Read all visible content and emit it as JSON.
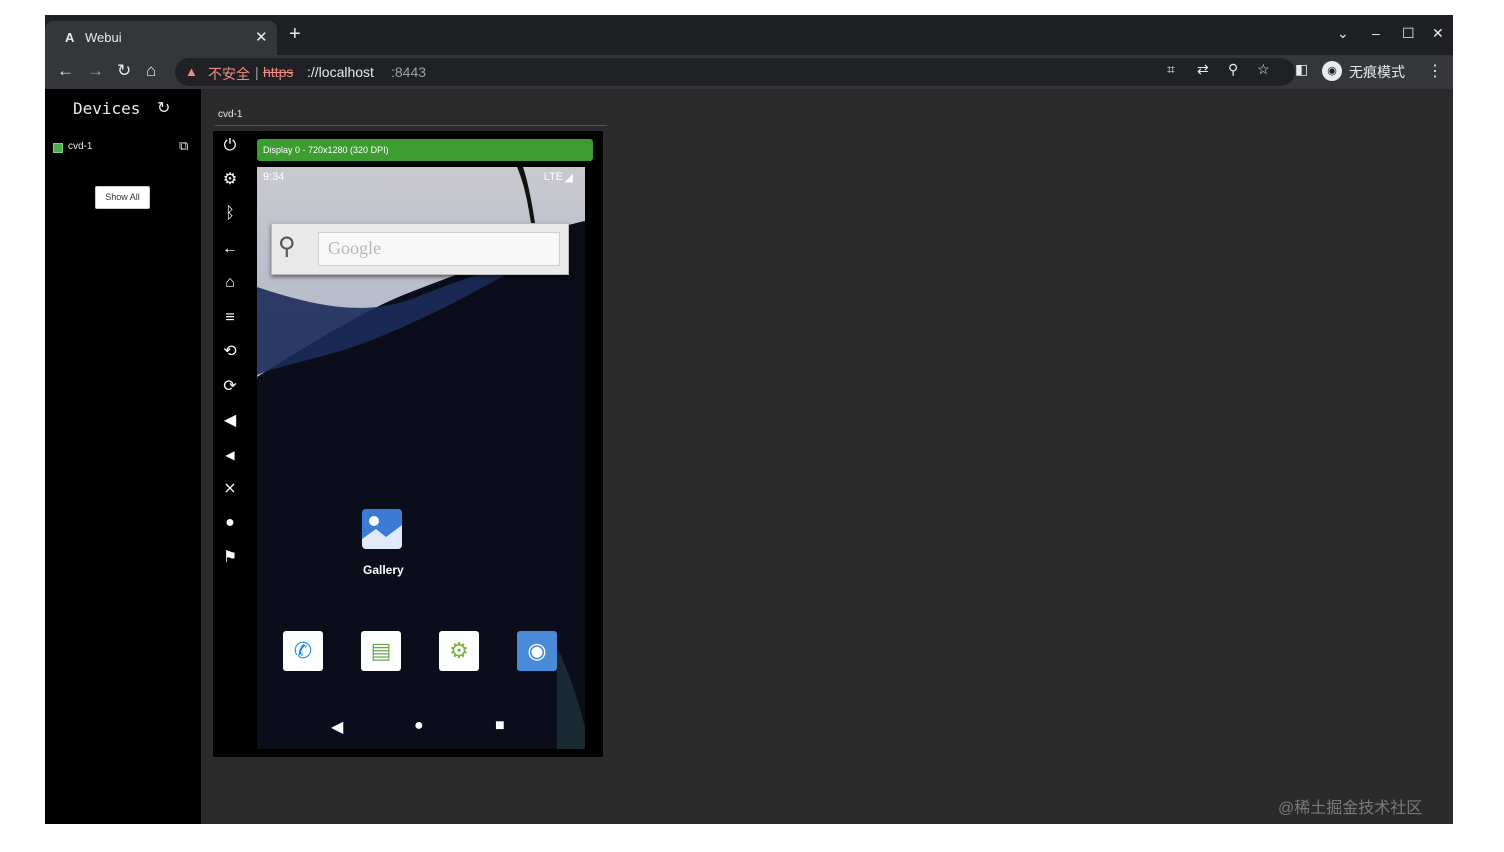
{
  "browser": {
    "tab_title": "Webui",
    "tab_favicon": "A",
    "warning_text": "不安全",
    "url_scheme": "https",
    "url_host": "://localhost",
    "url_port": ":8443",
    "profile_label": "无痕模式"
  },
  "sidebar": {
    "title": "Devices",
    "device_name": "cvd-1",
    "show_all": "Show All"
  },
  "device": {
    "tab_label": "cvd-1",
    "display_label": "Display 0 - 720x1280 (320 DPI)",
    "status_time": "9:34",
    "status_network": "LTE",
    "search_placeholder": "Google",
    "gallery_label": "Gallery"
  },
  "controls": [
    "power-icon",
    "settings-icon",
    "bluetooth-icon",
    "back-icon",
    "home-icon",
    "menu-icon",
    "rotate-left-icon",
    "rotate-right-icon",
    "volume-up-icon",
    "volume-down-icon",
    "volume-mute-icon",
    "microphone-icon",
    "location-icon"
  ],
  "watermark": "@稀土掘金技术社区",
  "colors": {
    "display_label_bg": "#3b9c2f",
    "page_bg": "#2b2b2b",
    "sidebar_bg": "#000000"
  }
}
